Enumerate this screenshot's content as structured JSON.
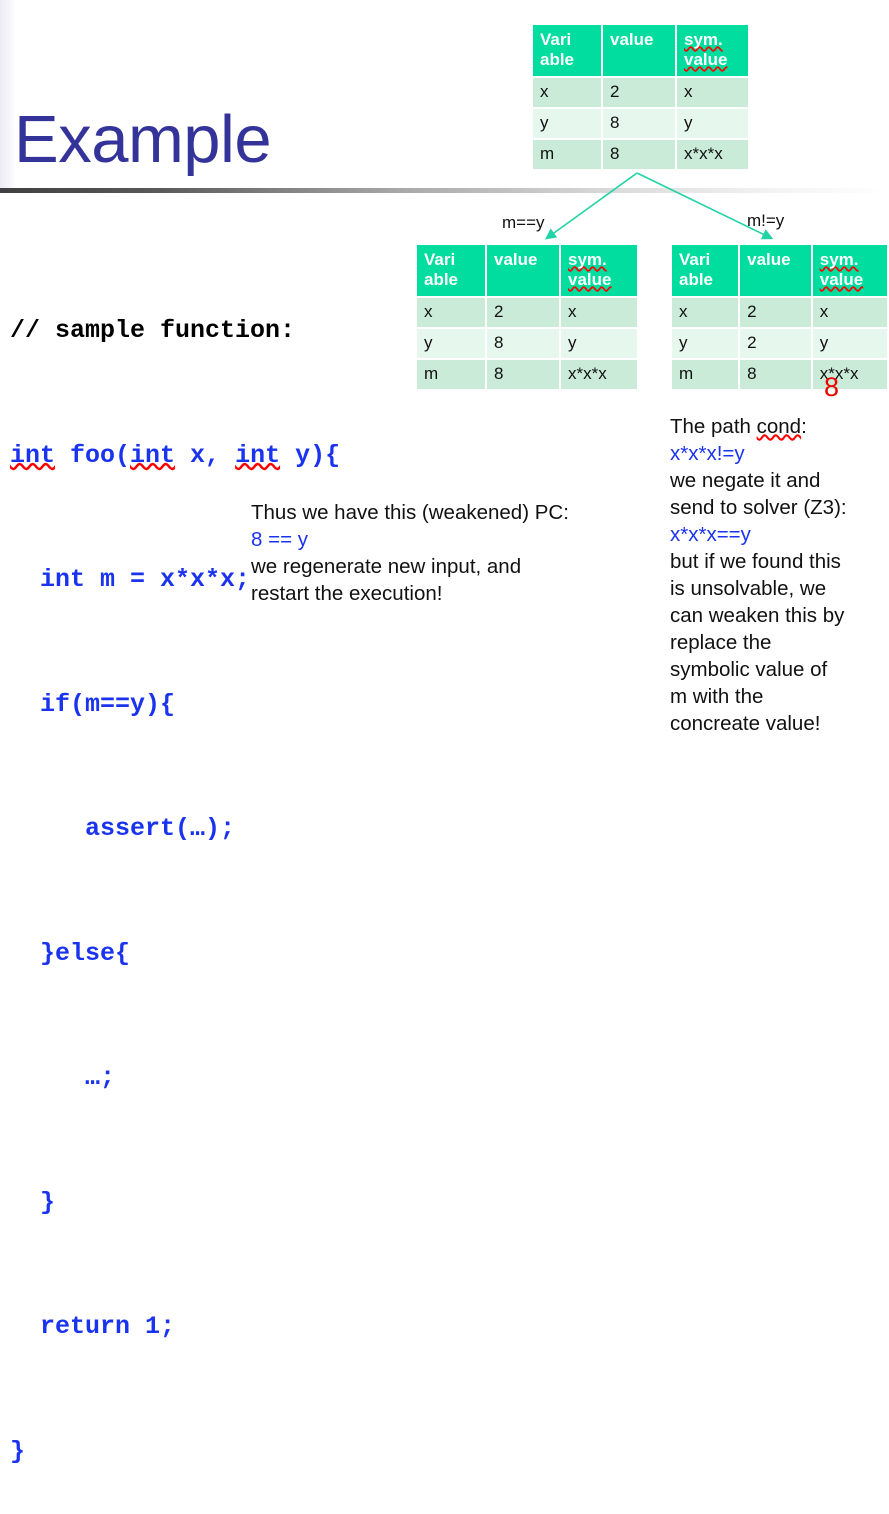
{
  "slide": {
    "title": "Example"
  },
  "code": {
    "lines": [
      {
        "text": "// sample function:",
        "color": "black"
      },
      {
        "text": "int foo(int x, int y){",
        "color": "blue"
      },
      {
        "text": "  int m = x*x*x;",
        "color": "blue"
      },
      {
        "text": "  if(m==y){",
        "color": "blue"
      },
      {
        "text": "     assert(…);",
        "color": "blue"
      },
      {
        "text": "  }else{",
        "color": "blue"
      },
      {
        "text": "     …;",
        "color": "blue"
      },
      {
        "text": "  }",
        "color": "blue"
      },
      {
        "text": "  return 1;",
        "color": "blue"
      },
      {
        "text": "}",
        "color": "blue"
      }
    ]
  },
  "tables": {
    "headers": {
      "variable": "Variable",
      "variable_l1": "Vari",
      "variable_l2": "able",
      "value": "value",
      "sym_l1": "sym.",
      "sym_l2": "value"
    },
    "top": {
      "rows": [
        {
          "variable": "x",
          "value": "2",
          "sym": "x"
        },
        {
          "variable": "y",
          "value": "8",
          "sym": "y"
        },
        {
          "variable": "m",
          "value": "8",
          "sym": "x*x*x"
        }
      ]
    },
    "left": {
      "rows": [
        {
          "variable": "x",
          "value": "2",
          "sym": "x"
        },
        {
          "variable": "y",
          "value": "8",
          "sym": "y"
        },
        {
          "variable": "m",
          "value": "8",
          "sym": "x*x*x"
        }
      ]
    },
    "right": {
      "rows": [
        {
          "variable": "x",
          "value": "2",
          "sym": "x"
        },
        {
          "variable": "y",
          "value": "2",
          "sym": "y"
        },
        {
          "variable": "m",
          "value": "8",
          "sym": "x*x*x"
        }
      ],
      "annotation": "8"
    }
  },
  "arrows": {
    "true_branch_label": "m==y",
    "false_branch_label": "m!=y"
  },
  "prose": {
    "middle": {
      "line1": "Thus we have this (weakened) PC:",
      "line2": "8 == y",
      "line3": "we regenerate new input, and",
      "line4": "restart the execution!"
    },
    "right": {
      "line1": "The path cond:",
      "line2": "x*x*x!=y",
      "line3": "we negate it and",
      "line4": "send to solver (Z3):",
      "line5": "x*x*x==y",
      "line6": "but if we found this",
      "line7": "is unsolvable, we",
      "line8": "can weaken this by",
      "line9": "replace the",
      "line10": "symbolic value of",
      "line11": "m with the",
      "line12": "concreate value!"
    }
  },
  "colors": {
    "title": "#333399",
    "table_header": "#00DD9E",
    "table_row_a": "#C9EBD8",
    "table_row_b": "#E6F7EE",
    "code_blue": "#1a33ee",
    "annotation_red": "#ee0000",
    "arrow": "#22D3A6"
  }
}
